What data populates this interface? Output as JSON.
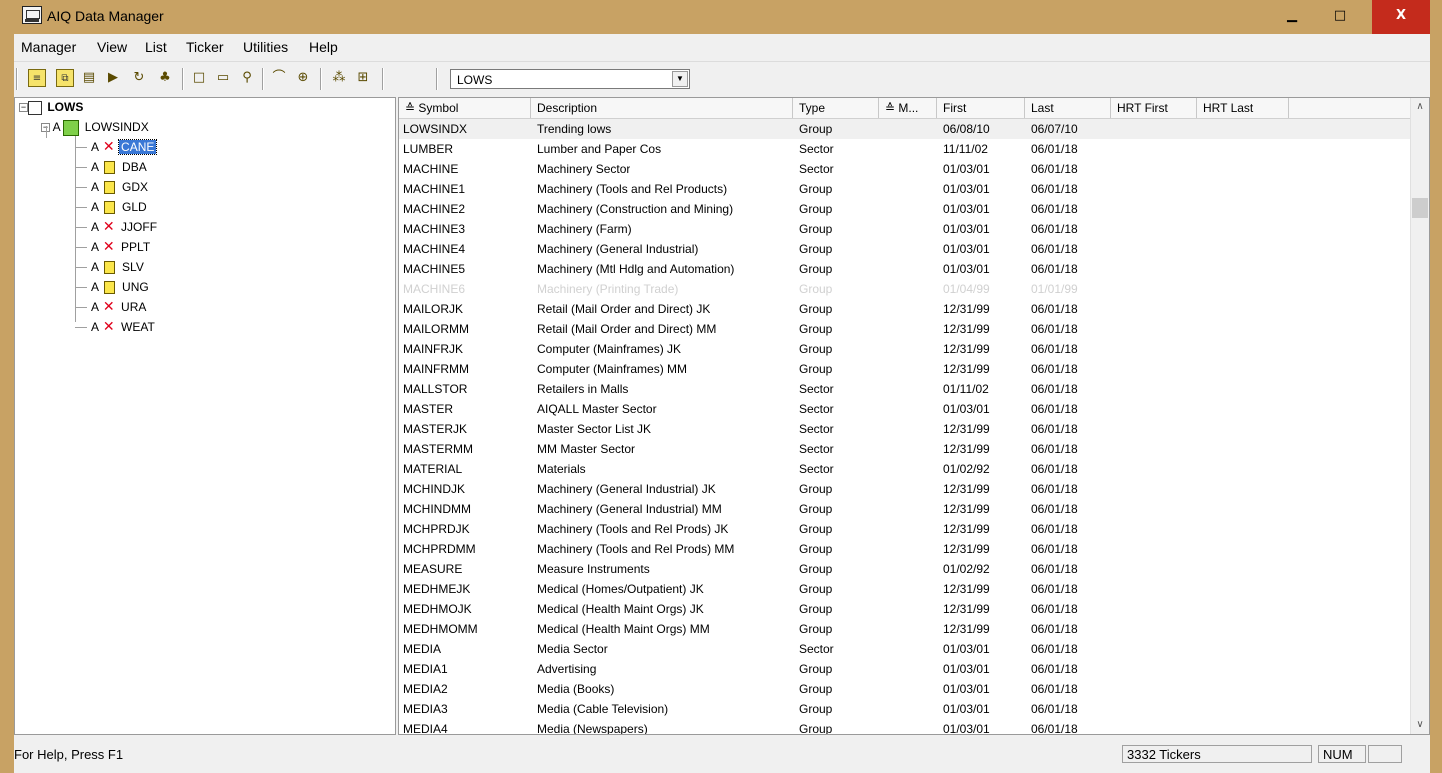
{
  "window": {
    "title": "AIQ Data Manager",
    "min": "▁",
    "max": "□",
    "close": "X"
  },
  "menu": [
    "Manager",
    "View",
    "List",
    "Ticker",
    "Utilities",
    "Help"
  ],
  "toolbar": {
    "combo_value": "LOWS"
  },
  "tree": {
    "root": "LOWS",
    "group": {
      "prefix": "A",
      "label": "LOWSINDX"
    },
    "items": [
      {
        "prefix": "A",
        "label": "CANE",
        "icon": "x",
        "selected": true
      },
      {
        "prefix": "A",
        "label": "DBA",
        "icon": "doc"
      },
      {
        "prefix": "A",
        "label": "GDX",
        "icon": "doc"
      },
      {
        "prefix": "A",
        "label": "GLD",
        "icon": "doc"
      },
      {
        "prefix": "A",
        "label": "JJOFF",
        "icon": "x"
      },
      {
        "prefix": "A",
        "label": "PPLT",
        "icon": "x"
      },
      {
        "prefix": "A",
        "label": "SLV",
        "icon": "doc"
      },
      {
        "prefix": "A",
        "label": "UNG",
        "icon": "doc"
      },
      {
        "prefix": "A",
        "label": "URA",
        "icon": "x"
      },
      {
        "prefix": "A",
        "label": "WEAT",
        "icon": "x"
      }
    ]
  },
  "columns": [
    "Symbol",
    "Description",
    "Type",
    "M...",
    "First",
    "Last",
    "HRT First",
    "HRT Last"
  ],
  "rows": [
    [
      "LOWSINDX",
      "Trending lows",
      "Group",
      "",
      "06/08/10",
      "06/07/10"
    ],
    [
      "LUMBER",
      "Lumber and Paper Cos",
      "Sector",
      "",
      "11/11/02",
      "06/01/18"
    ],
    [
      "MACHINE",
      "Machinery Sector",
      "Sector",
      "",
      "01/03/01",
      "06/01/18"
    ],
    [
      "MACHINE1",
      "Machinery (Tools and Rel Products)",
      "Group",
      "",
      "01/03/01",
      "06/01/18"
    ],
    [
      "MACHINE2",
      "Machinery (Construction and Mining)",
      "Group",
      "",
      "01/03/01",
      "06/01/18"
    ],
    [
      "MACHINE3",
      "Machinery (Farm)",
      "Group",
      "",
      "01/03/01",
      "06/01/18"
    ],
    [
      "MACHINE4",
      "Machinery (General Industrial)",
      "Group",
      "",
      "01/03/01",
      "06/01/18"
    ],
    [
      "MACHINE5",
      "Machinery (Mtl Hdlg and Automation)",
      "Group",
      "",
      "01/03/01",
      "06/01/18"
    ],
    [
      "MACHINE6",
      "Machinery (Printing Trade)",
      "Group",
      "",
      "01/04/99",
      "01/01/99"
    ],
    [
      "MAILORJK",
      "Retail (Mail Order and Direct) JK",
      "Group",
      "",
      "12/31/99",
      "06/01/18"
    ],
    [
      "MAILORMM",
      "Retail (Mail Order and Direct) MM",
      "Group",
      "",
      "12/31/99",
      "06/01/18"
    ],
    [
      "MAINFRJK",
      "Computer (Mainframes) JK",
      "Group",
      "",
      "12/31/99",
      "06/01/18"
    ],
    [
      "MAINFRMM",
      "Computer (Mainframes) MM",
      "Group",
      "",
      "12/31/99",
      "06/01/18"
    ],
    [
      "MALLSTOR",
      "Retailers in Malls",
      "Sector",
      "",
      "01/11/02",
      "06/01/18"
    ],
    [
      "MASTER",
      "AIQALL Master Sector",
      "Sector",
      "",
      "01/03/01",
      "06/01/18"
    ],
    [
      "MASTERJK",
      "Master Sector List JK",
      "Sector",
      "",
      "12/31/99",
      "06/01/18"
    ],
    [
      "MASTERMM",
      "MM Master Sector",
      "Sector",
      "",
      "12/31/99",
      "06/01/18"
    ],
    [
      "MATERIAL",
      "Materials",
      "Sector",
      "",
      "01/02/92",
      "06/01/18"
    ],
    [
      "MCHINDJK",
      "Machinery (General Industrial) JK",
      "Group",
      "",
      "12/31/99",
      "06/01/18"
    ],
    [
      "MCHINDMM",
      "Machinery (General Industrial) MM",
      "Group",
      "",
      "12/31/99",
      "06/01/18"
    ],
    [
      "MCHPRDJK",
      "Machinery (Tools and Rel Prods) JK",
      "Group",
      "",
      "12/31/99",
      "06/01/18"
    ],
    [
      "MCHPRDMM",
      "Machinery (Tools and Rel Prods) MM",
      "Group",
      "",
      "12/31/99",
      "06/01/18"
    ],
    [
      "MEASURE",
      "Measure Instruments",
      "Group",
      "",
      "01/02/92",
      "06/01/18"
    ],
    [
      "MEDHMEJK",
      "Medical (Homes/Outpatient) JK",
      "Group",
      "",
      "12/31/99",
      "06/01/18"
    ],
    [
      "MEDHMOJK",
      "Medical (Health Maint Orgs) JK",
      "Group",
      "",
      "12/31/99",
      "06/01/18"
    ],
    [
      "MEDHMOMM",
      "Medical (Health Maint Orgs) MM",
      "Group",
      "",
      "12/31/99",
      "06/01/18"
    ],
    [
      "MEDIA",
      "Media Sector",
      "Sector",
      "",
      "01/03/01",
      "06/01/18"
    ],
    [
      "MEDIA1",
      "Advertising",
      "Group",
      "",
      "01/03/01",
      "06/01/18"
    ],
    [
      "MEDIA2",
      "Media (Books)",
      "Group",
      "",
      "01/03/01",
      "06/01/18"
    ],
    [
      "MEDIA3",
      "Media (Cable Television)",
      "Group",
      "",
      "01/03/01",
      "06/01/18"
    ],
    [
      "MEDIA4",
      "Media (Newspapers)",
      "Group",
      "",
      "01/03/01",
      "06/01/18"
    ]
  ],
  "status": {
    "help": "For Help, Press F1",
    "count": "3332 Tickers",
    "num": "NUM"
  },
  "colors": {
    "frame": "#c8a264",
    "selection": "#3a78d6",
    "invalid": "#e0001b"
  }
}
